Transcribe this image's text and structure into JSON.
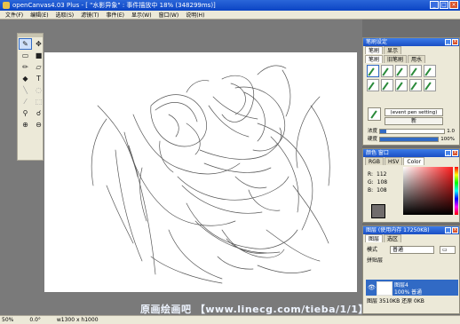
{
  "window": {
    "title": "openCanvas4.03 Plus - [ \"水影异象\" : 事件描放中 18% (348299ms)]"
  },
  "menu": [
    "文件(F)",
    "编辑(E)",
    "选取(S)",
    "滤镜(T)",
    "事件(E)",
    "显示(W)",
    "窗口(W)",
    "说明(H)"
  ],
  "tools": [
    "pen-icon",
    "move-icon",
    "rect-select-icon",
    "fill-rect-icon",
    "pencil-icon",
    "eraser-icon",
    "fill-bucket-icon",
    "text-icon",
    "line-icon",
    "lasso-icon",
    "magic-wand-icon",
    "transform-icon",
    "eyedropper-icon",
    "smudge-icon",
    "zoom-in-icon",
    "zoom-out-icon"
  ],
  "brush_panel": {
    "title": "笔刷设定",
    "top_tabs": [
      "笔刷",
      "显示"
    ],
    "tabs": [
      "笔刷",
      "旧笔刷",
      "用水"
    ],
    "brush_name": "(event pen setting)",
    "button": "新",
    "sliders": [
      {
        "label": "浓度",
        "value_text": "1.0",
        "value": 0.1
      },
      {
        "label": "硬度",
        "value_text": "100%",
        "value": 1.0
      }
    ]
  },
  "color_panel": {
    "title": "颜色 窗口",
    "tabs": [
      "RGB",
      "HSV",
      "Color"
    ],
    "r_label": "R:",
    "r": "112",
    "g_label": "G:",
    "g": "108",
    "b_label": "B:",
    "b": "108",
    "current_color": "#706c6c"
  },
  "layer_panel": {
    "title": "图层 (使用内存 17250KB)",
    "tabs": [
      "图层",
      "选区"
    ],
    "mode_label": "模式",
    "mode": "普通",
    "group_label": "拼贴层",
    "layer_name": "图层4",
    "layer_info": "100% 普通",
    "bottom": "图层 3510KB 还原 0KB"
  },
  "status": {
    "zoom": "50%",
    "angle": "0.0°",
    "size": "w1300 x h1000"
  },
  "watermark": "原画绘画吧 【www.linecg.com/tieba/1/1】"
}
